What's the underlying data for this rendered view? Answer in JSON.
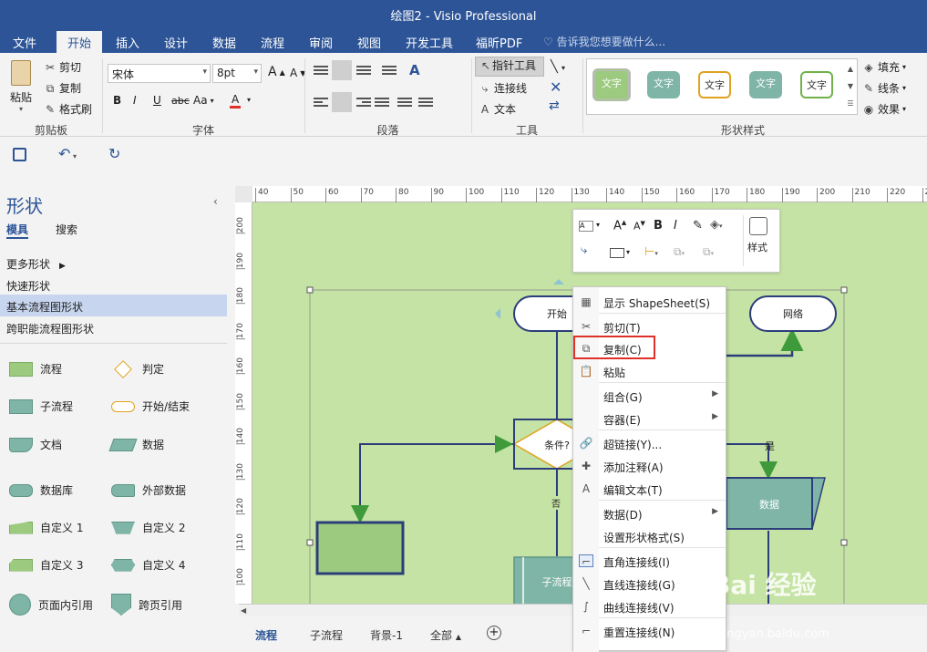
{
  "window": {
    "title": "绘图2 - Visio Professional"
  },
  "ribbon_tabs": [
    "文件",
    "开始",
    "插入",
    "设计",
    "数据",
    "流程",
    "审阅",
    "视图",
    "开发工具",
    "福昕PDF"
  ],
  "active_tab": "开始",
  "tell_me": "告诉我您想要做什么...",
  "clipboard": {
    "paste": "粘贴",
    "cut": "剪切",
    "copy": "复制",
    "format_painter": "格式刷",
    "label": "剪贴板"
  },
  "font": {
    "name": "宋体",
    "size": "8pt",
    "grow": "A",
    "shrink": "A",
    "bold": "B",
    "italic": "I",
    "underline": "U",
    "strike": "abc",
    "case": "Aa",
    "color": "A",
    "label": "字体"
  },
  "paragraph": {
    "label": "段落"
  },
  "tools": {
    "pointer": "指针工具",
    "connector": "连接线",
    "text": "文本",
    "label": "工具"
  },
  "shape_styles": {
    "label": "形状样式",
    "swatch_text": "文字",
    "fill": "填充",
    "line": "线条",
    "effects": "效果"
  },
  "stencil_pane": {
    "title": "形状",
    "tabs": [
      "模具",
      "搜索"
    ],
    "items": [
      "更多形状",
      "快速形状",
      "基本流程图形状",
      "跨职能流程图形状"
    ],
    "selected": "基本流程图形状",
    "shapes": [
      [
        "流程",
        "判定"
      ],
      [
        "子流程",
        "开始/结束"
      ],
      [
        "文档",
        "数据"
      ],
      [
        "数据库",
        "外部数据"
      ],
      [
        "自定义 1",
        "自定义 2"
      ],
      [
        "自定义 3",
        "自定义 4"
      ],
      [
        "页面内引用",
        "跨页引用"
      ]
    ]
  },
  "ruler": {
    "top": [
      "40",
      "50",
      "60",
      "70",
      "80",
      "90",
      "100",
      "110",
      "120",
      "130",
      "140",
      "150",
      "160",
      "170",
      "180",
      "190",
      "200",
      "210",
      "220",
      "230"
    ],
    "left": [
      "200",
      "190",
      "180",
      "170",
      "160",
      "150",
      "140",
      "130",
      "120",
      "110",
      "100"
    ]
  },
  "diagram": {
    "start": "开始",
    "network": "网络",
    "condition": "条件?",
    "data": "数据",
    "subprocess": "子流程",
    "yes": "是",
    "no": "否"
  },
  "mini_toolbar": {
    "styles": "样式"
  },
  "context_menu": [
    {
      "label": "显示 ShapeSheet(S)",
      "icon": "sheet-icon"
    },
    {
      "label": "剪切(T)",
      "icon": "scissors-icon"
    },
    {
      "label": "复制(C)",
      "icon": "copy-icon"
    },
    {
      "label": "粘贴",
      "icon": "paste-icon"
    },
    {
      "label": "组合(G)",
      "submenu": true
    },
    {
      "label": "容器(E)",
      "submenu": true
    },
    {
      "label": "超链接(Y)...",
      "icon": "link-icon"
    },
    {
      "label": "添加注释(A)",
      "icon": "comment-icon"
    },
    {
      "label": "编辑文本(T)",
      "icon": "text-icon"
    },
    {
      "label": "数据(D)",
      "submenu": true
    },
    {
      "label": "设置形状格式(S)"
    },
    {
      "label": "直角连接线(I)",
      "icon": "right-angle-icon"
    },
    {
      "label": "直线连接线(G)",
      "icon": "straight-line-icon"
    },
    {
      "label": "曲线连接线(V)",
      "icon": "curve-icon"
    },
    {
      "label": "重置连接线(N)",
      "icon": "reset-icon"
    }
  ],
  "page_tabs": [
    "流程",
    "子流程",
    "背景-1",
    "全部"
  ],
  "active_page": "流程",
  "watermark": {
    "brand": "Bai 经验",
    "url": "jingyan.baidu.com"
  },
  "colors": {
    "accent": "#2c5497",
    "canvas": "#c5e3a4",
    "shape_teal": "#7fb5a6",
    "shape_green": "#9ccb7f",
    "highlight": "#e0302a"
  }
}
